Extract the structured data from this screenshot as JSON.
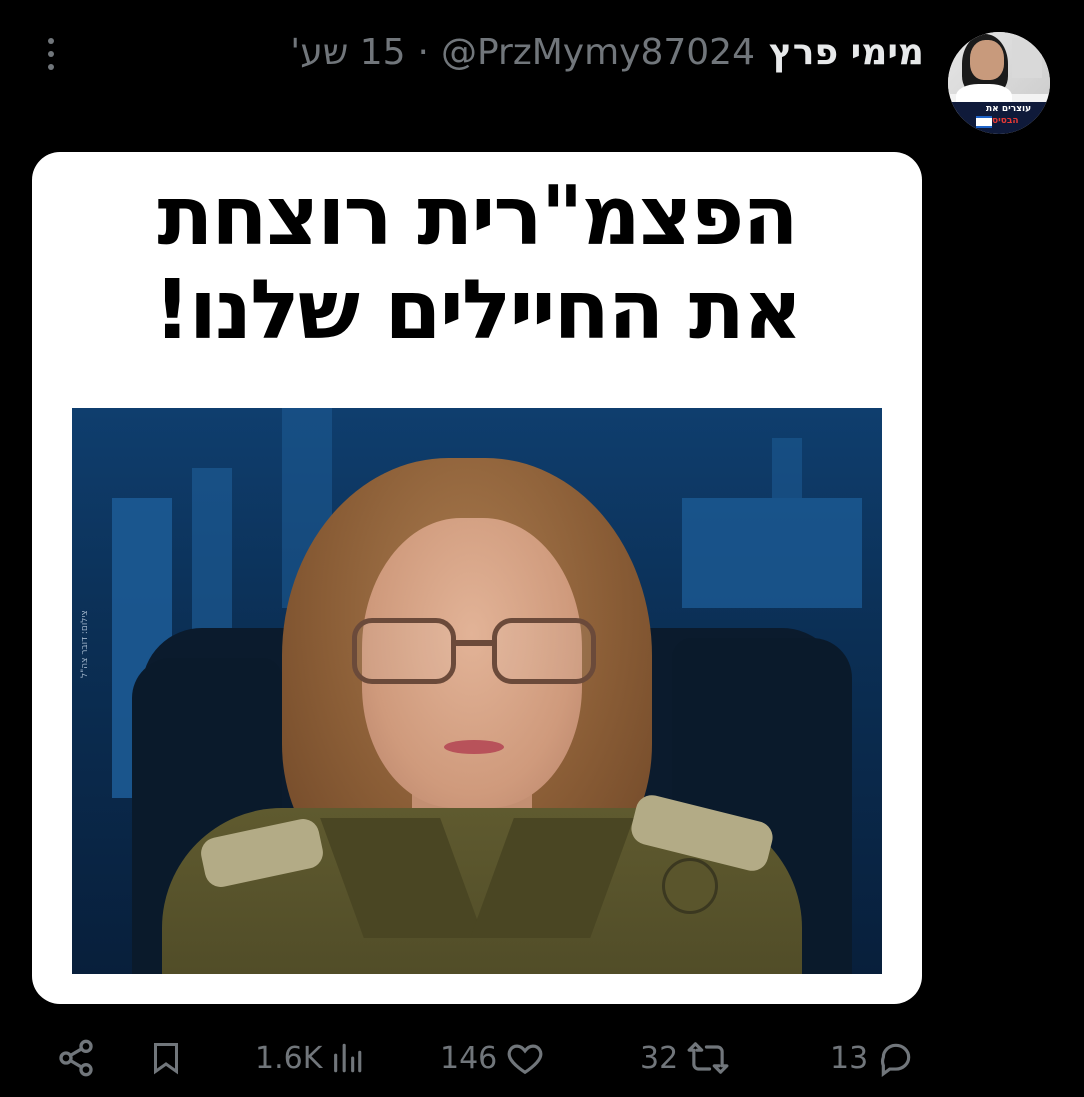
{
  "tweet": {
    "display_name": "מימי פרץ",
    "handle": "@PrzMymy87024",
    "separator": "·",
    "time": "15 שע'",
    "avatar_text_top": "עוצרים את",
    "avatar_text_bottom": "הבסיס"
  },
  "media": {
    "headline_line1": "הפצמ\"רית רוצחת",
    "headline_line2": "את החיילים שלנו!",
    "photo_credit": "צילום: דובר צה\"ל"
  },
  "actions": {
    "views": "1.6K",
    "likes": "146",
    "retweets": "32",
    "replies": "13"
  },
  "icons": {
    "more": "more-dots-icon",
    "share": "share-icon",
    "bookmark": "bookmark-icon",
    "views": "views-chart-icon",
    "likes": "heart-icon",
    "retweets": "retweet-icon",
    "replies": "reply-bubble-icon"
  },
  "colors": {
    "background": "#000000",
    "text_primary": "#e7e9ea",
    "text_secondary": "#71767b",
    "card_background": "#ffffff"
  }
}
